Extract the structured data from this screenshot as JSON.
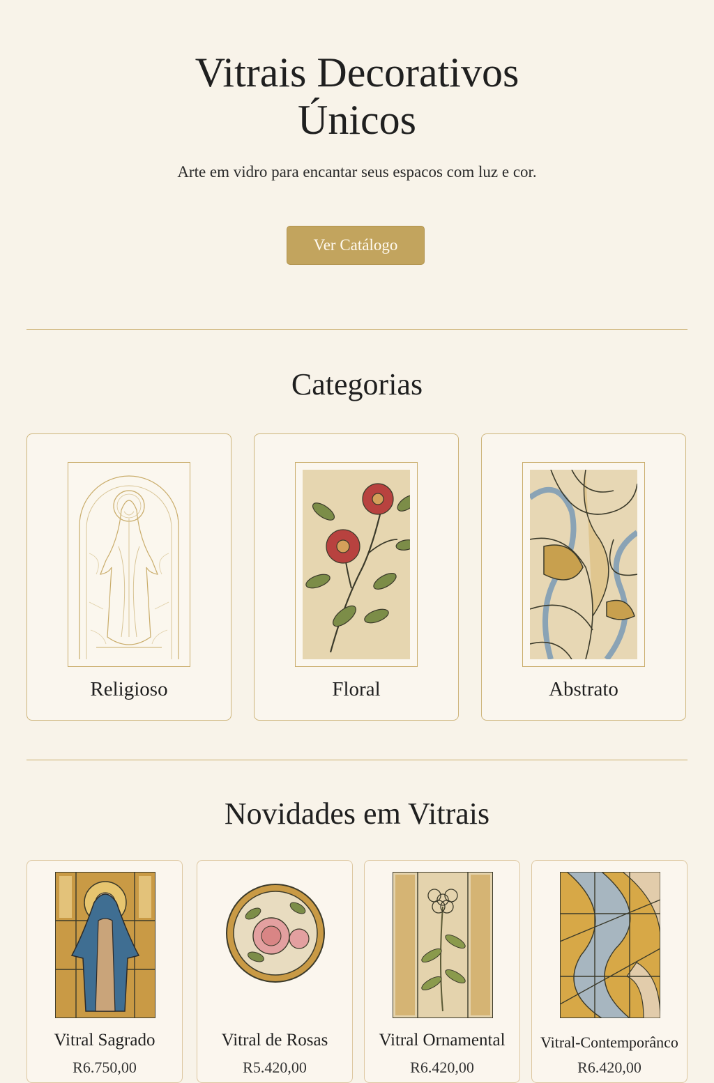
{
  "hero": {
    "title_line1": "Vitrais Decorativos",
    "title_line2": "Únicos",
    "subtitle": "Arte em vidro para encantar seus espacos com luz e cor.",
    "cta_label": "Ver Catálogo"
  },
  "categories": {
    "title": "Categorias",
    "items": [
      {
        "label": "Religioso",
        "icon": "religious-stained-glass-sketch"
      },
      {
        "label": "Floral",
        "icon": "floral-stained-glass"
      },
      {
        "label": "Abstrato",
        "icon": "abstract-stained-glass"
      }
    ]
  },
  "products": {
    "title": "Novidades em Vitrais",
    "items": [
      {
        "name": "Vitral Sagrado",
        "price": "R6.750,00",
        "icon": "madonna-stained-glass"
      },
      {
        "name": "Vitral de Rosas",
        "price": "R5.420,00",
        "icon": "rose-round-stained-glass"
      },
      {
        "name": "Vitral Ornamental",
        "price": "R6.420,00",
        "icon": "ornamental-flower-stained-glass"
      },
      {
        "name": "Vitral-Contemporânco",
        "price": "R6.420,00",
        "icon": "contemporary-stained-glass"
      }
    ]
  },
  "colors": {
    "background": "#f8f3e9",
    "accent_gold": "#c2a45e",
    "divider": "#c9ac6a",
    "text": "#1f1f1f"
  }
}
